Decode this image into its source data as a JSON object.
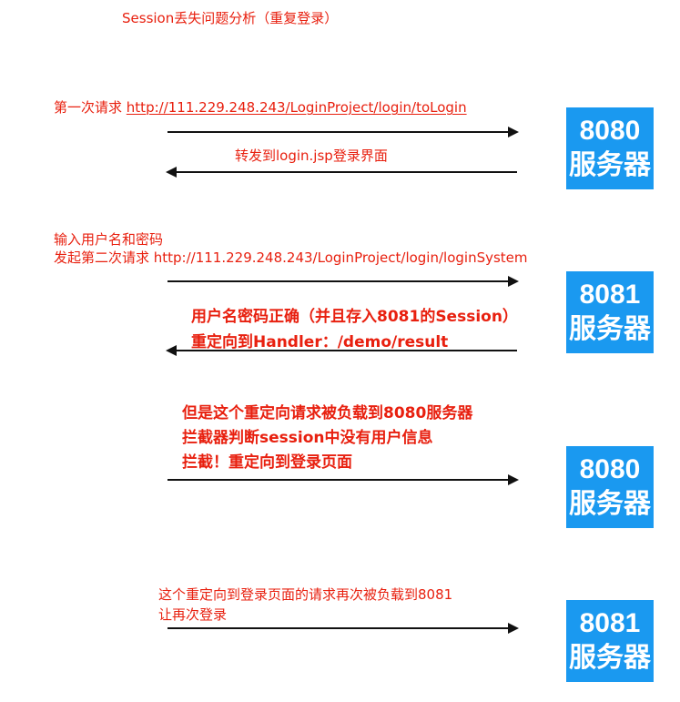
{
  "title": "Session丢失问题分析（重复登录）",
  "step1": {
    "label": "第一次请求",
    "url": "http://111.229.248.243/LoginProject/login/toLogin",
    "response": "转发到login.jsp登录界面",
    "server_port": "8080",
    "server_name": "服务器"
  },
  "step2": {
    "line1": "输入用户名和密码",
    "line2": "发起第二次请求 http://111.229.248.243/LoginProject/login/loginSystem",
    "response_line1": "用户名密码正确（并且存入8081的Session）",
    "response_line2": "重定向到Handler：/demo/result",
    "server_port": "8081",
    "server_name": "服务器"
  },
  "step3": {
    "line1": "但是这个重定向请求被负载到8080服务器",
    "line2": "拦截器判断session中没有用户信息",
    "line3": "拦截！重定向到登录页面",
    "server_port": "8080",
    "server_name": "服务器"
  },
  "step4": {
    "line1": "这个重定向到登录页面的请求再次被负载到8081",
    "line2": "让再次登录",
    "server_port": "8081",
    "server_name": "服务器"
  },
  "colors": {
    "annotation_red": "#e8200f",
    "server_blue": "#1a99f0",
    "arrow": "#111111"
  }
}
